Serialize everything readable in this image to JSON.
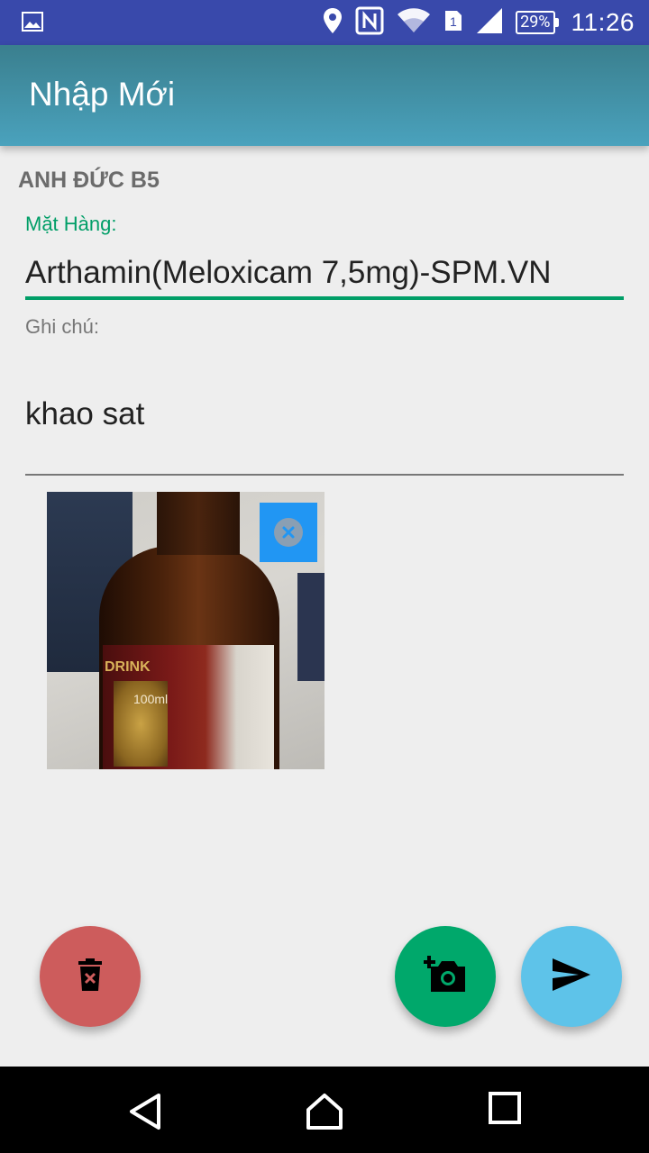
{
  "status_bar": {
    "battery": "29%",
    "time": "11:26",
    "icons": [
      "image-icon",
      "location-icon",
      "nfc-icon",
      "wifi-icon",
      "sim1-icon",
      "signal-icon",
      "battery-icon"
    ]
  },
  "app_bar": {
    "title": "Nhập Mới"
  },
  "form": {
    "customer": "ANH ĐỨC B5",
    "item_label": "Mặt Hàng:",
    "item_value": "Arthamin(Meloxicam 7,5mg)-SPM.VN",
    "note_label": "Ghi chú:",
    "note_value": "khao sat"
  },
  "photo": {
    "bottle_text": "DRINK",
    "bottle_volume": "100ml"
  },
  "actions": {
    "delete_icon": "trash-icon",
    "camera_icon": "add-photo-icon",
    "send_icon": "send-icon"
  },
  "colors": {
    "status_bar": "#3949ab",
    "accent_green": "#009e67",
    "fab_delete": "#cd5c5c",
    "fab_camera": "#00a86b",
    "fab_send": "#5ec3e9",
    "remove_button": "#2196f3"
  }
}
